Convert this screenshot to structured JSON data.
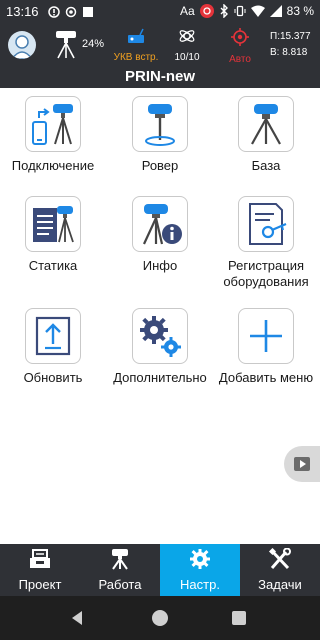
{
  "status_bar": {
    "time": "13:16",
    "font_badge": "Aa",
    "battery_pct": "83 %"
  },
  "instrument_bar": {
    "battery": "24%",
    "radio_label": "УКВ встр.",
    "satellites": "10/10",
    "fix_label": "Авто",
    "coord_north": "П:15.377",
    "coord_east": "В: 8.818"
  },
  "title": "PRIN-new",
  "tiles": [
    {
      "label": "Подключение"
    },
    {
      "label": "Ровер"
    },
    {
      "label": "База"
    },
    {
      "label": "Статика"
    },
    {
      "label": "Инфо"
    },
    {
      "label": "Регистрация оборудования"
    },
    {
      "label": "Обновить"
    },
    {
      "label": "Дополнительно"
    },
    {
      "label": "Добавить меню"
    }
  ],
  "bottom_nav": [
    {
      "label": "Проект",
      "active": false
    },
    {
      "label": "Работа",
      "active": false
    },
    {
      "label": "Настр.",
      "active": true
    },
    {
      "label": "Задачи",
      "active": false
    }
  ],
  "colors": {
    "bar_bg": "#2f3136",
    "accent": "#0aa6e8",
    "radio": "#f0a020",
    "fix": "#e5333a"
  }
}
